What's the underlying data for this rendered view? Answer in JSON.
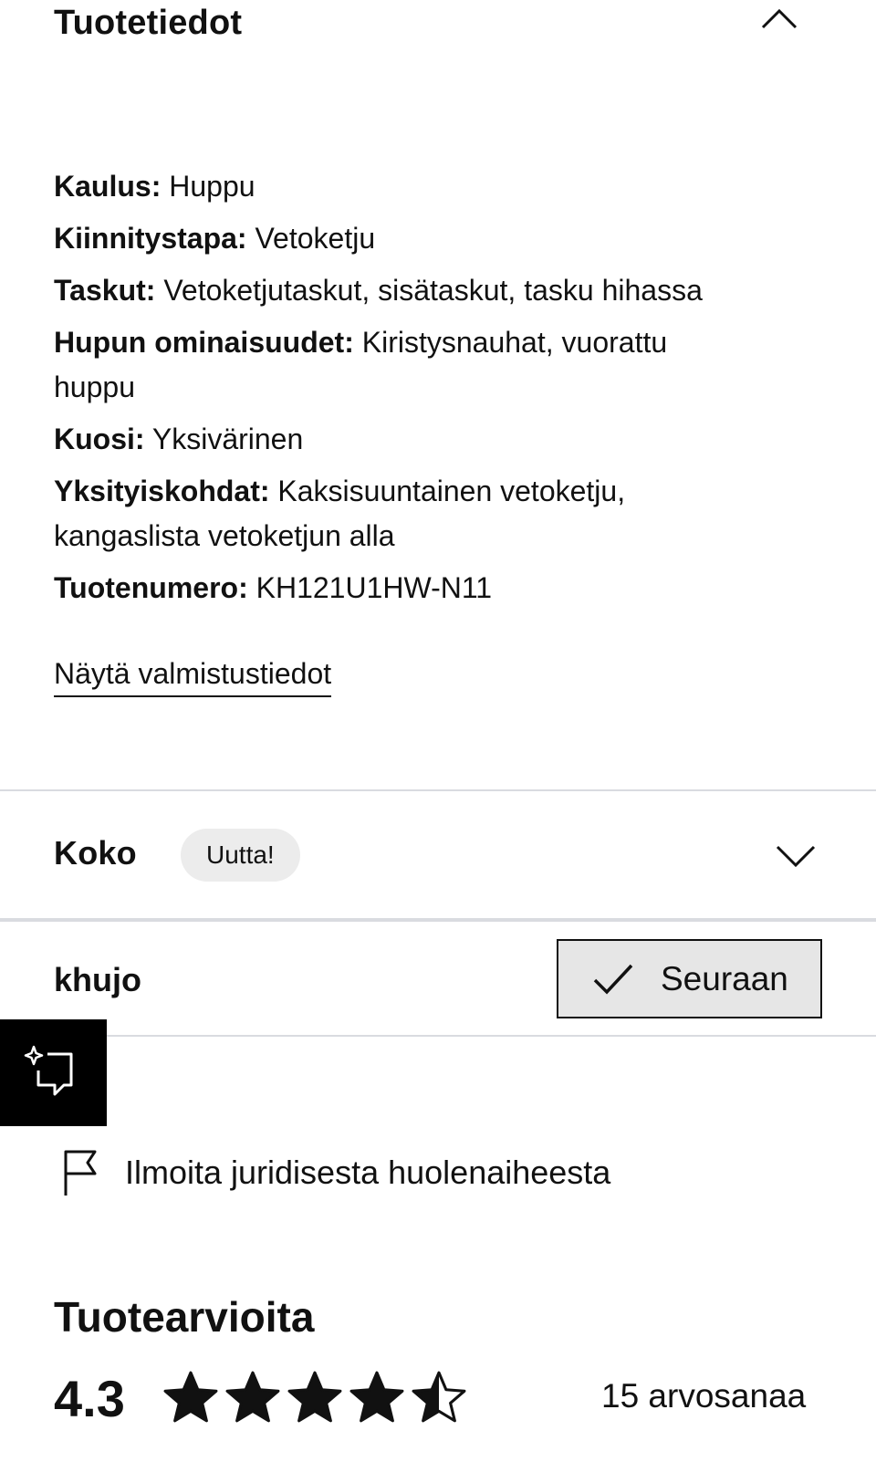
{
  "details": {
    "title": "Tuotetiedot",
    "collapse_icon": "chevron-up-icon",
    "attributes": [
      {
        "label": "Kaulus:",
        "value": "Huppu"
      },
      {
        "label": "Kiinnitystapa:",
        "value": "Vetoketju"
      },
      {
        "label": "Taskut:",
        "value": "Vetoketjutaskut, sisätaskut, tasku hihassa"
      },
      {
        "label": "Hupun ominaisuudet:",
        "value": "Kiristysnauhat, vuorattu",
        "value2": "huppu"
      },
      {
        "label": "Kuosi:",
        "value": "Yksivärinen"
      },
      {
        "label": "Yksityiskohdat:",
        "value": "Kaksisuuntainen vetoketju,",
        "value2": "kangaslista vetoketjun alla"
      },
      {
        "label": "Tuotenumero:",
        "value": "KH121U1HW-N11"
      }
    ],
    "manufacturing_link": "Näytä valmistustiedot"
  },
  "size": {
    "title": "Koko",
    "badge": "Uutta!",
    "expand_icon": "chevron-down-icon"
  },
  "brand": {
    "name": "khujo",
    "follow_label": "Seuraan",
    "follow_icon": "check-icon"
  },
  "ai_assistant": {
    "icon": "sparkle-chat-icon"
  },
  "report": {
    "icon": "flag-icon",
    "label": "Ilmoita juridisesta huolenaiheesta"
  },
  "reviews": {
    "title": "Tuotearvioita",
    "rating": "4.3",
    "rating_value": 4.3,
    "max_stars": 5,
    "count_label": "15 arvosanaa"
  },
  "colors": {
    "text": "#111111",
    "divider": "#d9dbe0",
    "badge_bg": "#ececec",
    "button_bg": "#e6e6e6",
    "ai_bg": "#000000"
  }
}
